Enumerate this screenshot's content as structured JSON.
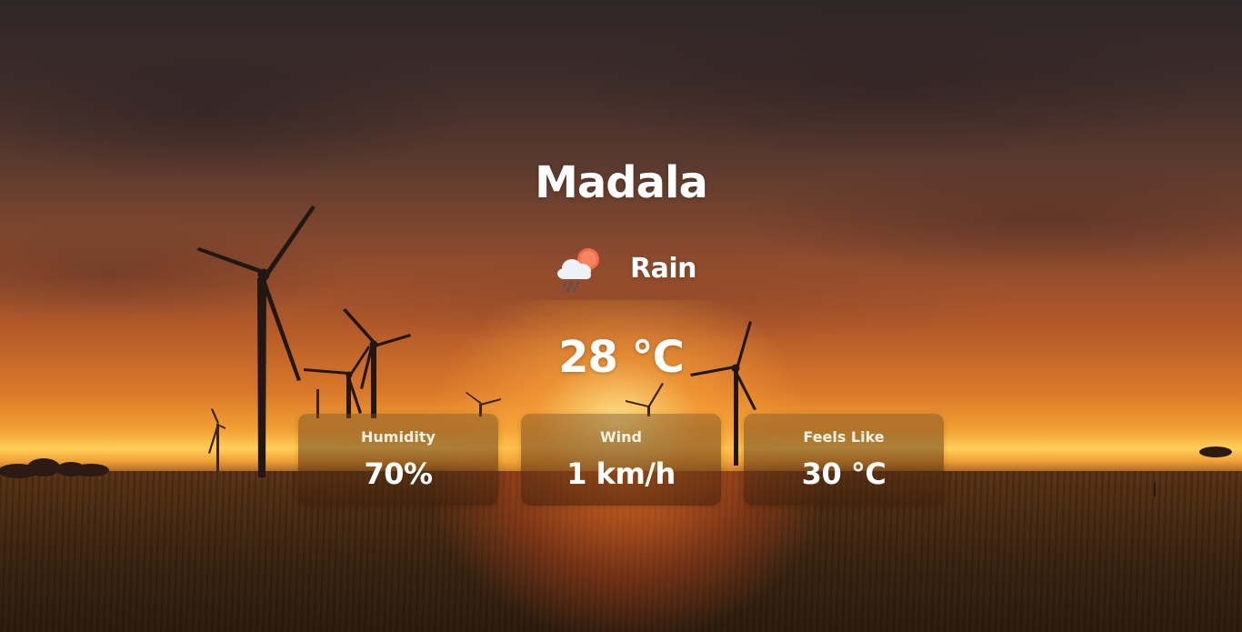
{
  "location": {
    "city": "Madala"
  },
  "current": {
    "condition": "Rain",
    "condition_icon": "rain-cloud-sun-icon",
    "temperature": "28 °C"
  },
  "stats": [
    {
      "label": "Humidity",
      "value": "70%"
    },
    {
      "label": "Wind",
      "value": "1 km/h"
    },
    {
      "label": "Feels Like",
      "value": "30 °C"
    }
  ],
  "background": {
    "scene": "sunset-wind-turbines",
    "accent_sun": "#ffcf5a",
    "accent_sky": "#b45a2a"
  }
}
